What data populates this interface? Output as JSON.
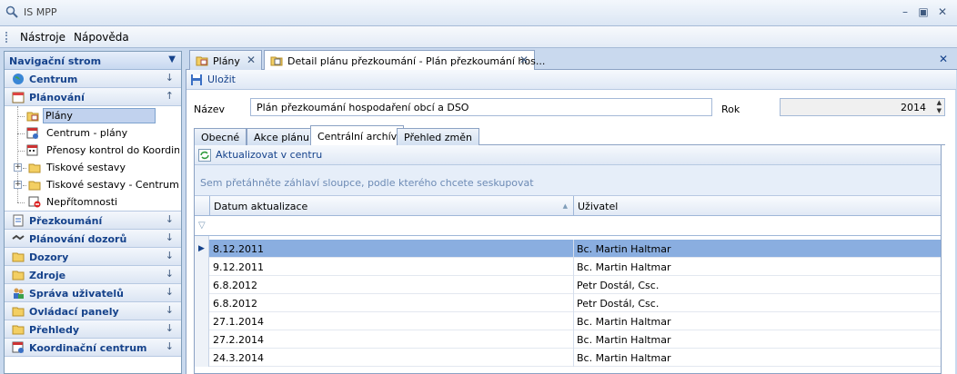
{
  "window": {
    "title": "IS MPP"
  },
  "menu": {
    "items": [
      "Nástroje",
      "Nápověda"
    ]
  },
  "nav": {
    "header": "Navigační strom",
    "groups_top": [
      {
        "label": "Centrum",
        "icon": "globe-icon"
      },
      {
        "label": "Plánování",
        "icon": "calendar-icon"
      }
    ],
    "tree": [
      {
        "label": "Plány",
        "icon": "folder-calendar-icon",
        "selected": true,
        "expandable": false
      },
      {
        "label": "Centrum - plány",
        "icon": "calendar-star-icon",
        "selected": false,
        "expandable": false
      },
      {
        "label": "Přenosy kontrol do Koordin...",
        "icon": "calendar-transfer-icon",
        "selected": false,
        "expandable": false
      },
      {
        "label": "Tiskové sestavy",
        "icon": "folder-icon",
        "selected": false,
        "expandable": true
      },
      {
        "label": "Tiskové sestavy - Centrum",
        "icon": "folder-icon",
        "selected": false,
        "expandable": true
      },
      {
        "label": "Nepřítomnosti",
        "icon": "absence-icon",
        "selected": false,
        "expandable": false
      }
    ],
    "groups_bottom": [
      {
        "label": "Přezkoumání",
        "icon": "review-icon"
      },
      {
        "label": "Plánování dozorů",
        "icon": "handshake-icon"
      },
      {
        "label": "Dozory",
        "icon": "folder-icon"
      },
      {
        "label": "Zdroje",
        "icon": "folder-icon"
      },
      {
        "label": "Správa uživatelů",
        "icon": "users-icon"
      },
      {
        "label": "Ovládací panely",
        "icon": "folder-icon"
      },
      {
        "label": "Přehledy",
        "icon": "folder-icon"
      },
      {
        "label": "Koordinační centrum",
        "icon": "calendar-star-icon"
      }
    ]
  },
  "doc_tabs": [
    {
      "label": "Plány",
      "active": false
    },
    {
      "label": "Detail plánu přezkoumání - Plán přezkoumání hos...",
      "active": true
    }
  ],
  "toolbar": {
    "save_label": "Uložit"
  },
  "form": {
    "name_label": "Název",
    "name_value": "Plán přezkoumání hospodaření obcí a DSO",
    "year_label": "Rok",
    "year_value": "2014"
  },
  "inner_tabs": [
    "Obecné",
    "Akce plánu",
    "Centrální archív",
    "Přehled změn"
  ],
  "archive": {
    "refresh_label": "Aktualizovat v centru",
    "group_hint": "Sem přetáhněte záhlaví sloupce, podle kterého chcete seskupovat",
    "columns": [
      "Datum aktualizace",
      "Uživatel"
    ],
    "rows": [
      {
        "date": "8.12.2011",
        "user": "Bc. Martin Haltmar",
        "selected": true
      },
      {
        "date": "9.12.2011",
        "user": "Bc. Martin Haltmar",
        "selected": false
      },
      {
        "date": "6.8.2012",
        "user": "Petr Dostál, Csc.",
        "selected": false
      },
      {
        "date": "6.8.2012",
        "user": "Petr Dostál, Csc.",
        "selected": false
      },
      {
        "date": "27.1.2014",
        "user": "Bc. Martin Haltmar",
        "selected": false
      },
      {
        "date": "27.2.2014",
        "user": "Bc. Martin Haltmar",
        "selected": false
      },
      {
        "date": "24.3.2014",
        "user": "Bc. Martin Haltmar",
        "selected": false
      }
    ]
  }
}
